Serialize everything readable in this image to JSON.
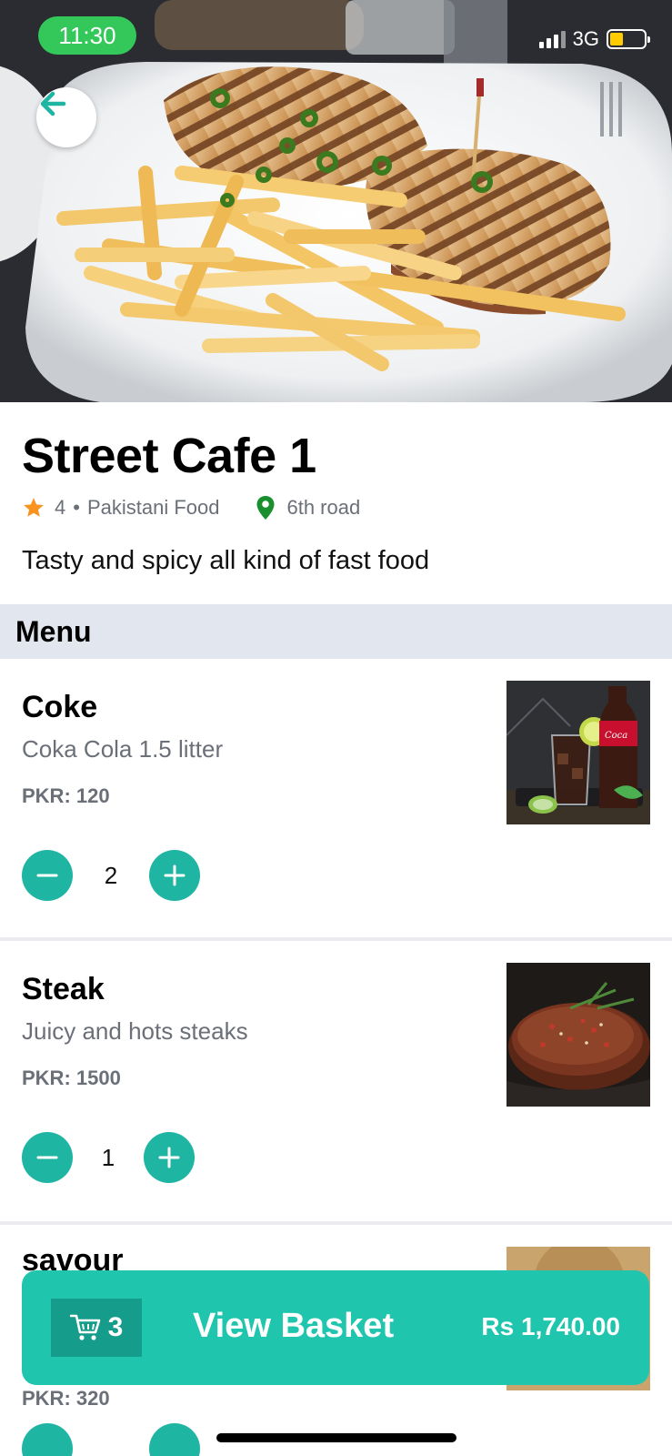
{
  "status_bar": {
    "time": "11:30",
    "network": "3G"
  },
  "restaurant": {
    "name": "Street Cafe 1",
    "rating": "4",
    "separator": "•",
    "cuisine": "Pakistani Food",
    "location": "6th road",
    "description": "Tasty and spicy all kind of fast food"
  },
  "menu": {
    "heading": "Menu",
    "items": [
      {
        "name": "Coke",
        "description": "Coka Cola 1.5 litter",
        "price": "PKR: 120",
        "quantity": "2"
      },
      {
        "name": "Steak",
        "description": "Juicy and hots steaks",
        "price": "PKR: 1500",
        "quantity": "1"
      },
      {
        "name": "savour",
        "description": "",
        "price": "PKR: 320"
      }
    ]
  },
  "basket": {
    "count": "3",
    "label": "View Basket",
    "total": "Rs 1,740.00"
  },
  "colors": {
    "accent": "#1fc5ad",
    "accent_dark": "#159c8a",
    "qty_button": "#1fb5a3",
    "status_pill": "#34c759",
    "star": "#f7931e",
    "pin": "#1a8f2e"
  },
  "icons": [
    "back-arrow-icon",
    "star-icon",
    "location-pin-icon",
    "minus-icon",
    "plus-icon",
    "cart-icon",
    "signal-icon",
    "battery-icon"
  ]
}
